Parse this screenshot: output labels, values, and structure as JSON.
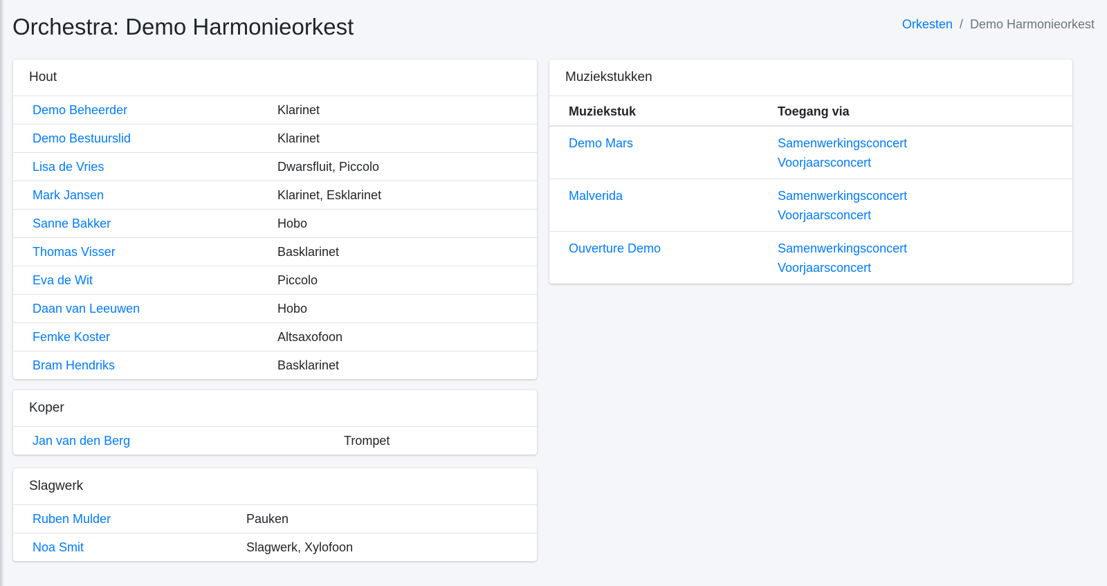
{
  "page": {
    "title": "Orchestra: Demo Harmonieorkest",
    "breadcrumb": {
      "link": "Orkesten",
      "separator": "/",
      "current": "Demo Harmonieorkest"
    }
  },
  "sections": {
    "hout": {
      "title": "Hout",
      "members": [
        {
          "name": "Demo Beheerder",
          "instrument": "Klarinet"
        },
        {
          "name": "Demo Bestuurslid",
          "instrument": "Klarinet"
        },
        {
          "name": "Lisa de Vries",
          "instrument": "Dwarsfluit, Piccolo"
        },
        {
          "name": "Mark Jansen",
          "instrument": "Klarinet, Esklarinet"
        },
        {
          "name": "Sanne Bakker",
          "instrument": "Hobo"
        },
        {
          "name": "Thomas Visser",
          "instrument": "Basklarinet"
        },
        {
          "name": "Eva de Wit",
          "instrument": "Piccolo"
        },
        {
          "name": "Daan van Leeuwen",
          "instrument": "Hobo"
        },
        {
          "name": "Femke Koster",
          "instrument": "Altsaxofoon"
        },
        {
          "name": "Bram Hendriks",
          "instrument": "Basklarinet"
        }
      ]
    },
    "koper": {
      "title": "Koper",
      "members": [
        {
          "name": "Jan van den Berg",
          "instrument": "Trompet"
        }
      ]
    },
    "slagwerk": {
      "title": "Slagwerk",
      "members": [
        {
          "name": "Ruben Mulder",
          "instrument": "Pauken"
        },
        {
          "name": "Noa Smit",
          "instrument": "Slagwerk, Xylofoon"
        }
      ]
    }
  },
  "pieces": {
    "title": "Muziekstukken",
    "headers": {
      "piece": "Muziekstuk",
      "access": "Toegang via"
    },
    "rows": [
      {
        "name": "Demo Mars",
        "via": [
          "Samenwerkingsconcert",
          "Voorjaarsconcert"
        ]
      },
      {
        "name": "Malverida",
        "via": [
          "Samenwerkingsconcert",
          "Voorjaarsconcert"
        ]
      },
      {
        "name": "Ouverture Demo",
        "via": [
          "Samenwerkingsconcert",
          "Voorjaarsconcert"
        ]
      }
    ]
  },
  "colors": {
    "link": "#007bff",
    "background": "#f4f6f9",
    "text": "#212529"
  }
}
